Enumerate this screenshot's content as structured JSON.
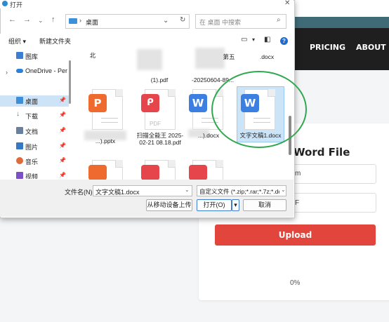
{
  "site": {
    "nav": {
      "pricing": "PRICING",
      "about": "ABOUT"
    },
    "card_title": "Word File",
    "field1_text": "m",
    "field2_text": "F",
    "upload_label": "Upload",
    "progress": "0%",
    "colors": {
      "header": "#1f1f1f",
      "upload": "#e2453c"
    }
  },
  "dialog": {
    "title": "打开",
    "address": {
      "location": "桌面"
    },
    "search_placeholder": "在 桌面 中搜索",
    "commands": {
      "organize": "组织 ▾",
      "new_folder": "新建文件夹"
    },
    "sidebar": [
      {
        "label": "图库",
        "icon": "gallery-icon",
        "pinned": false
      },
      {
        "label": "OneDrive - Per",
        "icon": "cloud-icon",
        "pinned": false
      },
      {
        "label": "桌面",
        "icon": "desktop-icon",
        "pinned": true,
        "selected": true
      },
      {
        "label": "下载",
        "icon": "download-icon",
        "pinned": true
      },
      {
        "label": "文档",
        "icon": "documents-icon",
        "pinned": true
      },
      {
        "label": "图片",
        "icon": "pictures-icon",
        "pinned": true
      },
      {
        "label": "音乐",
        "icon": "music-icon",
        "pinned": true
      },
      {
        "label": "视频",
        "icon": "video-icon",
        "pinned": true
      }
    ],
    "files_top_row": [
      {
        "label": "北"
      },
      {
        "label": "(1).pdf"
      },
      {
        "label": "第五"
      },
      {
        "label": ".docx"
      },
      {
        "label": "-20250604-89..."
      }
    ],
    "files": [
      {
        "name": "...).pptx",
        "type": "pptx",
        "icon_text": "P"
      },
      {
        "name": "扫描全能王 2025-02-21 08.18.pdf",
        "type": "pdf",
        "icon_text": "PDF"
      },
      {
        "name": "...).docx",
        "type": "docx",
        "icon_text": "W"
      },
      {
        "name": "文字文稿1.docx",
        "type": "docx",
        "icon_text": "W",
        "selected": true
      }
    ],
    "footer": {
      "filename_label": "文件名(N):",
      "filename_value": "文字文稿1.docx",
      "filetype_value": "自定义文件 (*.zip;*.rar;*.7z;*.dc",
      "mobile_upload": "从移动设备上传",
      "open": "打开(O)",
      "cancel": "取消"
    }
  }
}
